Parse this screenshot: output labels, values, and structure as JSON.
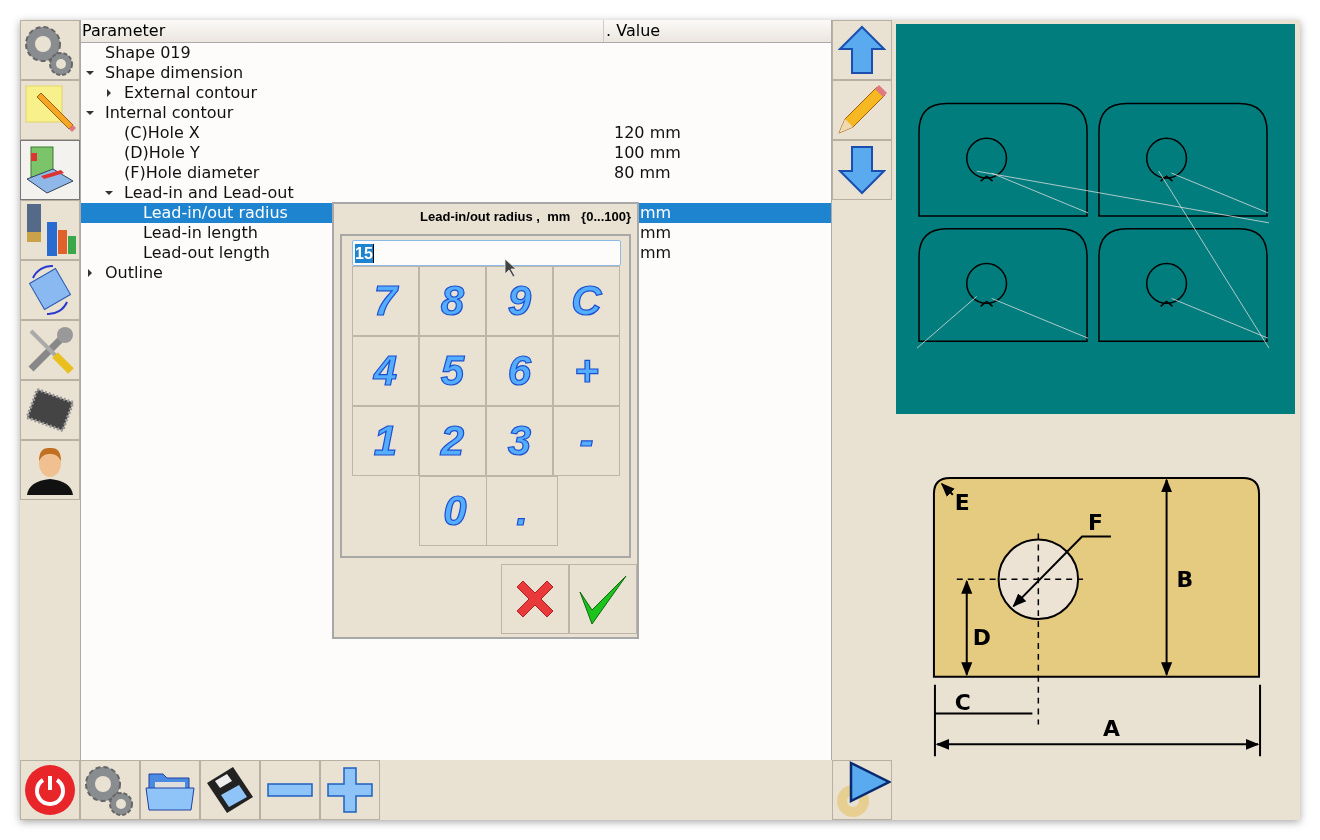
{
  "table": {
    "columns": [
      "Parameter",
      ". Value"
    ],
    "rows": [
      {
        "label": "Shape 019",
        "selected": false
      },
      {
        "label": "Shape dimension",
        "expanded": true,
        "selected": false,
        "children": [
          {
            "label": "External contour",
            "expanded": false,
            "selected": false
          }
        ]
      },
      {
        "label": "Internal contour",
        "expanded": true,
        "selected": false,
        "children": [
          {
            "label": "(C)Hole X",
            "value": "120 mm",
            "selected": false
          },
          {
            "label": "(D)Hole Y",
            "value": "100 mm",
            "selected": false
          },
          {
            "label": "(F)Hole diameter",
            "value": "80 mm",
            "selected": false
          },
          {
            "label": "Lead-in and Lead-out",
            "expanded": true,
            "selected": false,
            "children": [
              {
                "label": "Lead-in/out radius",
                "value": "mm",
                "value_cut": true,
                "selected": true
              },
              {
                "label": "Lead-in length",
                "value": "mm",
                "value_cut": true,
                "selected": false
              },
              {
                "label": "Lead-out length",
                "value": "mm",
                "value_cut": true,
                "selected": false
              }
            ]
          }
        ]
      },
      {
        "label": "Outline",
        "expanded": false,
        "selected": false
      }
    ]
  },
  "dialog": {
    "title": "Lead-in/out radius ,  mm   {0...100}",
    "value": "15",
    "keys": [
      [
        "7",
        "8",
        "9",
        "C"
      ],
      [
        "4",
        "5",
        "6",
        "+"
      ],
      [
        "1",
        "2",
        "3",
        "-"
      ],
      [
        "0",
        "."
      ]
    ]
  },
  "diagram": {
    "labels": [
      "E",
      "F",
      "B",
      "D",
      "C",
      "A"
    ]
  }
}
